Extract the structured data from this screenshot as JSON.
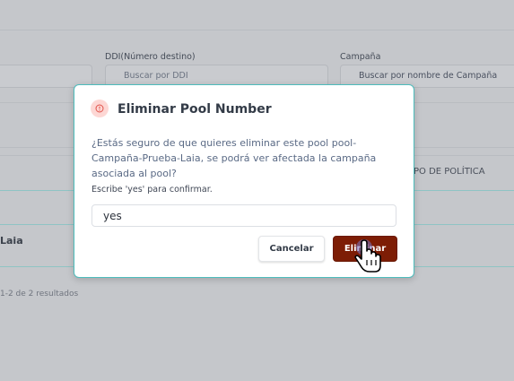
{
  "filters": {
    "ddi_label": "DDI(Número destino)",
    "ddi_placeholder": "Buscar por DDI",
    "campaign_label": "Campaña",
    "campaign_placeholder": "Buscar por nombre de Campaña"
  },
  "table": {
    "partial_header": "PO DE POLÍTICA",
    "row_partial_name": "Laia"
  },
  "pagination": {
    "results_text": "1-2 de 2 resultados"
  },
  "modal": {
    "title": "Eliminar Pool Number",
    "icon": "warning-icon",
    "message": "¿Estás seguro de que quieres eliminar este pool pool-Campaña-Prueba-Laia, se podrá ver afectada la campaña asociada al pool?",
    "hint": "Escribe 'yes' para confirmar.",
    "confirm_value": "yes",
    "cancel_label": "Cancelar",
    "delete_label": "Eliminar"
  },
  "colors": {
    "overlay": "#c5c7cb",
    "modal_border": "#4dbcbc",
    "delete_button": "#7d1d05",
    "icon_bg": "#fdd7d4",
    "icon_fg": "#e0524a"
  }
}
